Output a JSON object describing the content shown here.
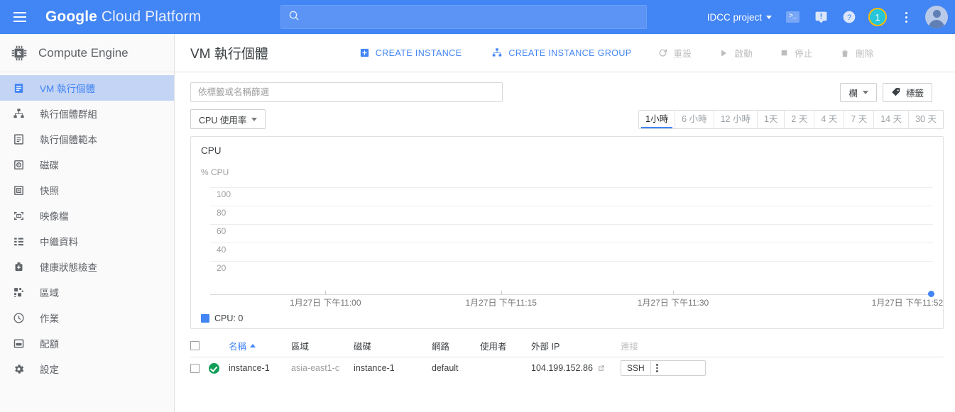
{
  "header": {
    "menu_icon": "hamburger-menu-icon",
    "brand_bold": "Google",
    "brand_rest": " Cloud Platform",
    "search_placeholder": "",
    "search_value": "",
    "search_icon": "search-icon",
    "project_name": "IDCC project",
    "cloud_shell_icon": "terminal-icon",
    "notifications_icon": "feedback-icon",
    "help_icon": "help-icon",
    "badge_count": "1",
    "more_icon": "vertical-dots-icon",
    "avatar_icon": "account-avatar"
  },
  "sidebar": {
    "product_icon": "cpu-chip-icon",
    "product_title": "Compute Engine",
    "items": [
      {
        "label": "VM 執行個體",
        "icon": "vm-instances-icon",
        "active": true
      },
      {
        "label": "執行個體群組",
        "icon": "instance-groups-icon",
        "active": false
      },
      {
        "label": "執行個體範本",
        "icon": "instance-templates-icon",
        "active": false
      },
      {
        "label": "磁碟",
        "icon": "disk-icon",
        "active": false
      },
      {
        "label": "快照",
        "icon": "snapshot-icon",
        "active": false
      },
      {
        "label": "映像檔",
        "icon": "image-icon",
        "active": false
      },
      {
        "label": "中繼資料",
        "icon": "metadata-icon",
        "active": false
      },
      {
        "label": "健康狀態檢查",
        "icon": "health-check-icon",
        "active": false
      },
      {
        "label": "區域",
        "icon": "zones-icon",
        "active": false
      },
      {
        "label": "作業",
        "icon": "operations-clock-icon",
        "active": false
      },
      {
        "label": "配額",
        "icon": "quota-icon",
        "active": false
      },
      {
        "label": "設定",
        "icon": "gear-icon",
        "active": false
      }
    ]
  },
  "toolbar": {
    "page_title": "VM 執行個體",
    "create_instance": "CREATE INSTANCE",
    "create_instance_icon": "add-instance-icon",
    "create_instance_group": "CREATE INSTANCE GROUP",
    "create_instance_group_icon": "add-instance-group-icon",
    "reset": "重設",
    "reset_icon": "refresh-icon",
    "start": "啟動",
    "start_icon": "play-icon",
    "stop": "停止",
    "stop_icon": "stop-square-icon",
    "delete": "刪除",
    "delete_icon": "trash-icon"
  },
  "filter": {
    "placeholder": "依標籤或名稱篩選",
    "value": "",
    "columns_label": "欄",
    "columns_icon": "chevron-down-icon",
    "labels_label": "標籤",
    "labels_icon": "tag-icon"
  },
  "metric": {
    "selector_label": "CPU 使用率",
    "selector_icon": "chevron-down-icon",
    "time_ranges": [
      "1小時",
      "6 小時",
      "12 小時",
      "1天",
      "2 天",
      "4 天",
      "7 天",
      "14 天",
      "30 天"
    ],
    "selected_range": "1小時"
  },
  "chart_data": {
    "type": "line",
    "title": "CPU",
    "ylabel": "% CPU",
    "xlabel": "",
    "ylim": [
      0,
      100
    ],
    "yticks": [
      100,
      80,
      60,
      40,
      20
    ],
    "grid": true,
    "x_tick_labels": [
      "1月27日 下午11:00",
      "1月27日 下午11:15",
      "1月27日 下午11:30",
      "1月27日 下午11:52"
    ],
    "series": [
      {
        "name": "CPU",
        "color": "#4285f4",
        "x": [
          "1月27日 下午11:52"
        ],
        "values": [
          0
        ]
      }
    ],
    "legend": {
      "label": "CPU: 0",
      "color": "#4285f4",
      "position": "bottom-left"
    }
  },
  "table": {
    "columns": [
      "名稱",
      "區域",
      "磁碟",
      "網路",
      "使用者",
      "外部 IP",
      "連接"
    ],
    "sort_column": "名稱",
    "sort_direction": "asc",
    "rows": [
      {
        "status": "running",
        "name": "instance-1",
        "zone": "asia-east1-c",
        "disk": "instance-1",
        "network": "default",
        "user": "",
        "external_ip": "104.199.152.86",
        "external_ip_icon": "external-link-icon",
        "connect_label": "SSH",
        "connect_menu_icon": "vertical-dots-icon"
      }
    ]
  },
  "colors": {
    "brand_blue": "#4285f4",
    "accent_green": "#0f9d58",
    "badge_cyan": "#26c6da",
    "badge_ring": "#fbbc04"
  }
}
